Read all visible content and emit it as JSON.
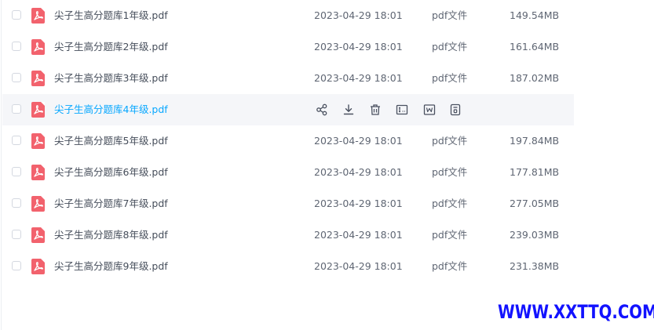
{
  "files": [
    {
      "name": "尖子生高分题库1年级.pdf",
      "date": "2023-04-29 18:01",
      "type": "pdf文件",
      "size": "149.54MB"
    },
    {
      "name": "尖子生高分题库2年级.pdf",
      "date": "2023-04-29 18:01",
      "type": "pdf文件",
      "size": "161.64MB"
    },
    {
      "name": "尖子生高分题库3年级.pdf",
      "date": "2023-04-29 18:01",
      "type": "pdf文件",
      "size": "187.02MB"
    },
    {
      "name": "尖子生高分题库4年级.pdf",
      "date": "",
      "type": "",
      "size": "",
      "hovered": true
    },
    {
      "name": "尖子生高分题库5年级.pdf",
      "date": "2023-04-29 18:01",
      "type": "pdf文件",
      "size": "197.84MB"
    },
    {
      "name": "尖子生高分题库6年级.pdf",
      "date": "2023-04-29 18:01",
      "type": "pdf文件",
      "size": "177.81MB"
    },
    {
      "name": "尖子生高分题库7年级.pdf",
      "date": "2023-04-29 18:01",
      "type": "pdf文件",
      "size": "277.05MB"
    },
    {
      "name": "尖子生高分题库8年级.pdf",
      "date": "2023-04-29 18:01",
      "type": "pdf文件",
      "size": "239.03MB"
    },
    {
      "name": "尖子生高分题库9年级.pdf",
      "date": "2023-04-29 18:01",
      "type": "pdf文件",
      "size": "231.38MB"
    }
  ],
  "row_actions": [
    {
      "icon": "share-icon"
    },
    {
      "icon": "download-icon"
    },
    {
      "icon": "delete-icon"
    },
    {
      "icon": "rename-icon"
    },
    {
      "icon": "word-convert-icon"
    },
    {
      "icon": "more-icon"
    }
  ],
  "colors": {
    "accent": "#06a7ff",
    "pdf_icon": "#f2626d",
    "hover_row": "#f5f6f9",
    "watermark": "#1212ff"
  },
  "watermark": {
    "text": "WWW.XXTTQ.COM"
  }
}
